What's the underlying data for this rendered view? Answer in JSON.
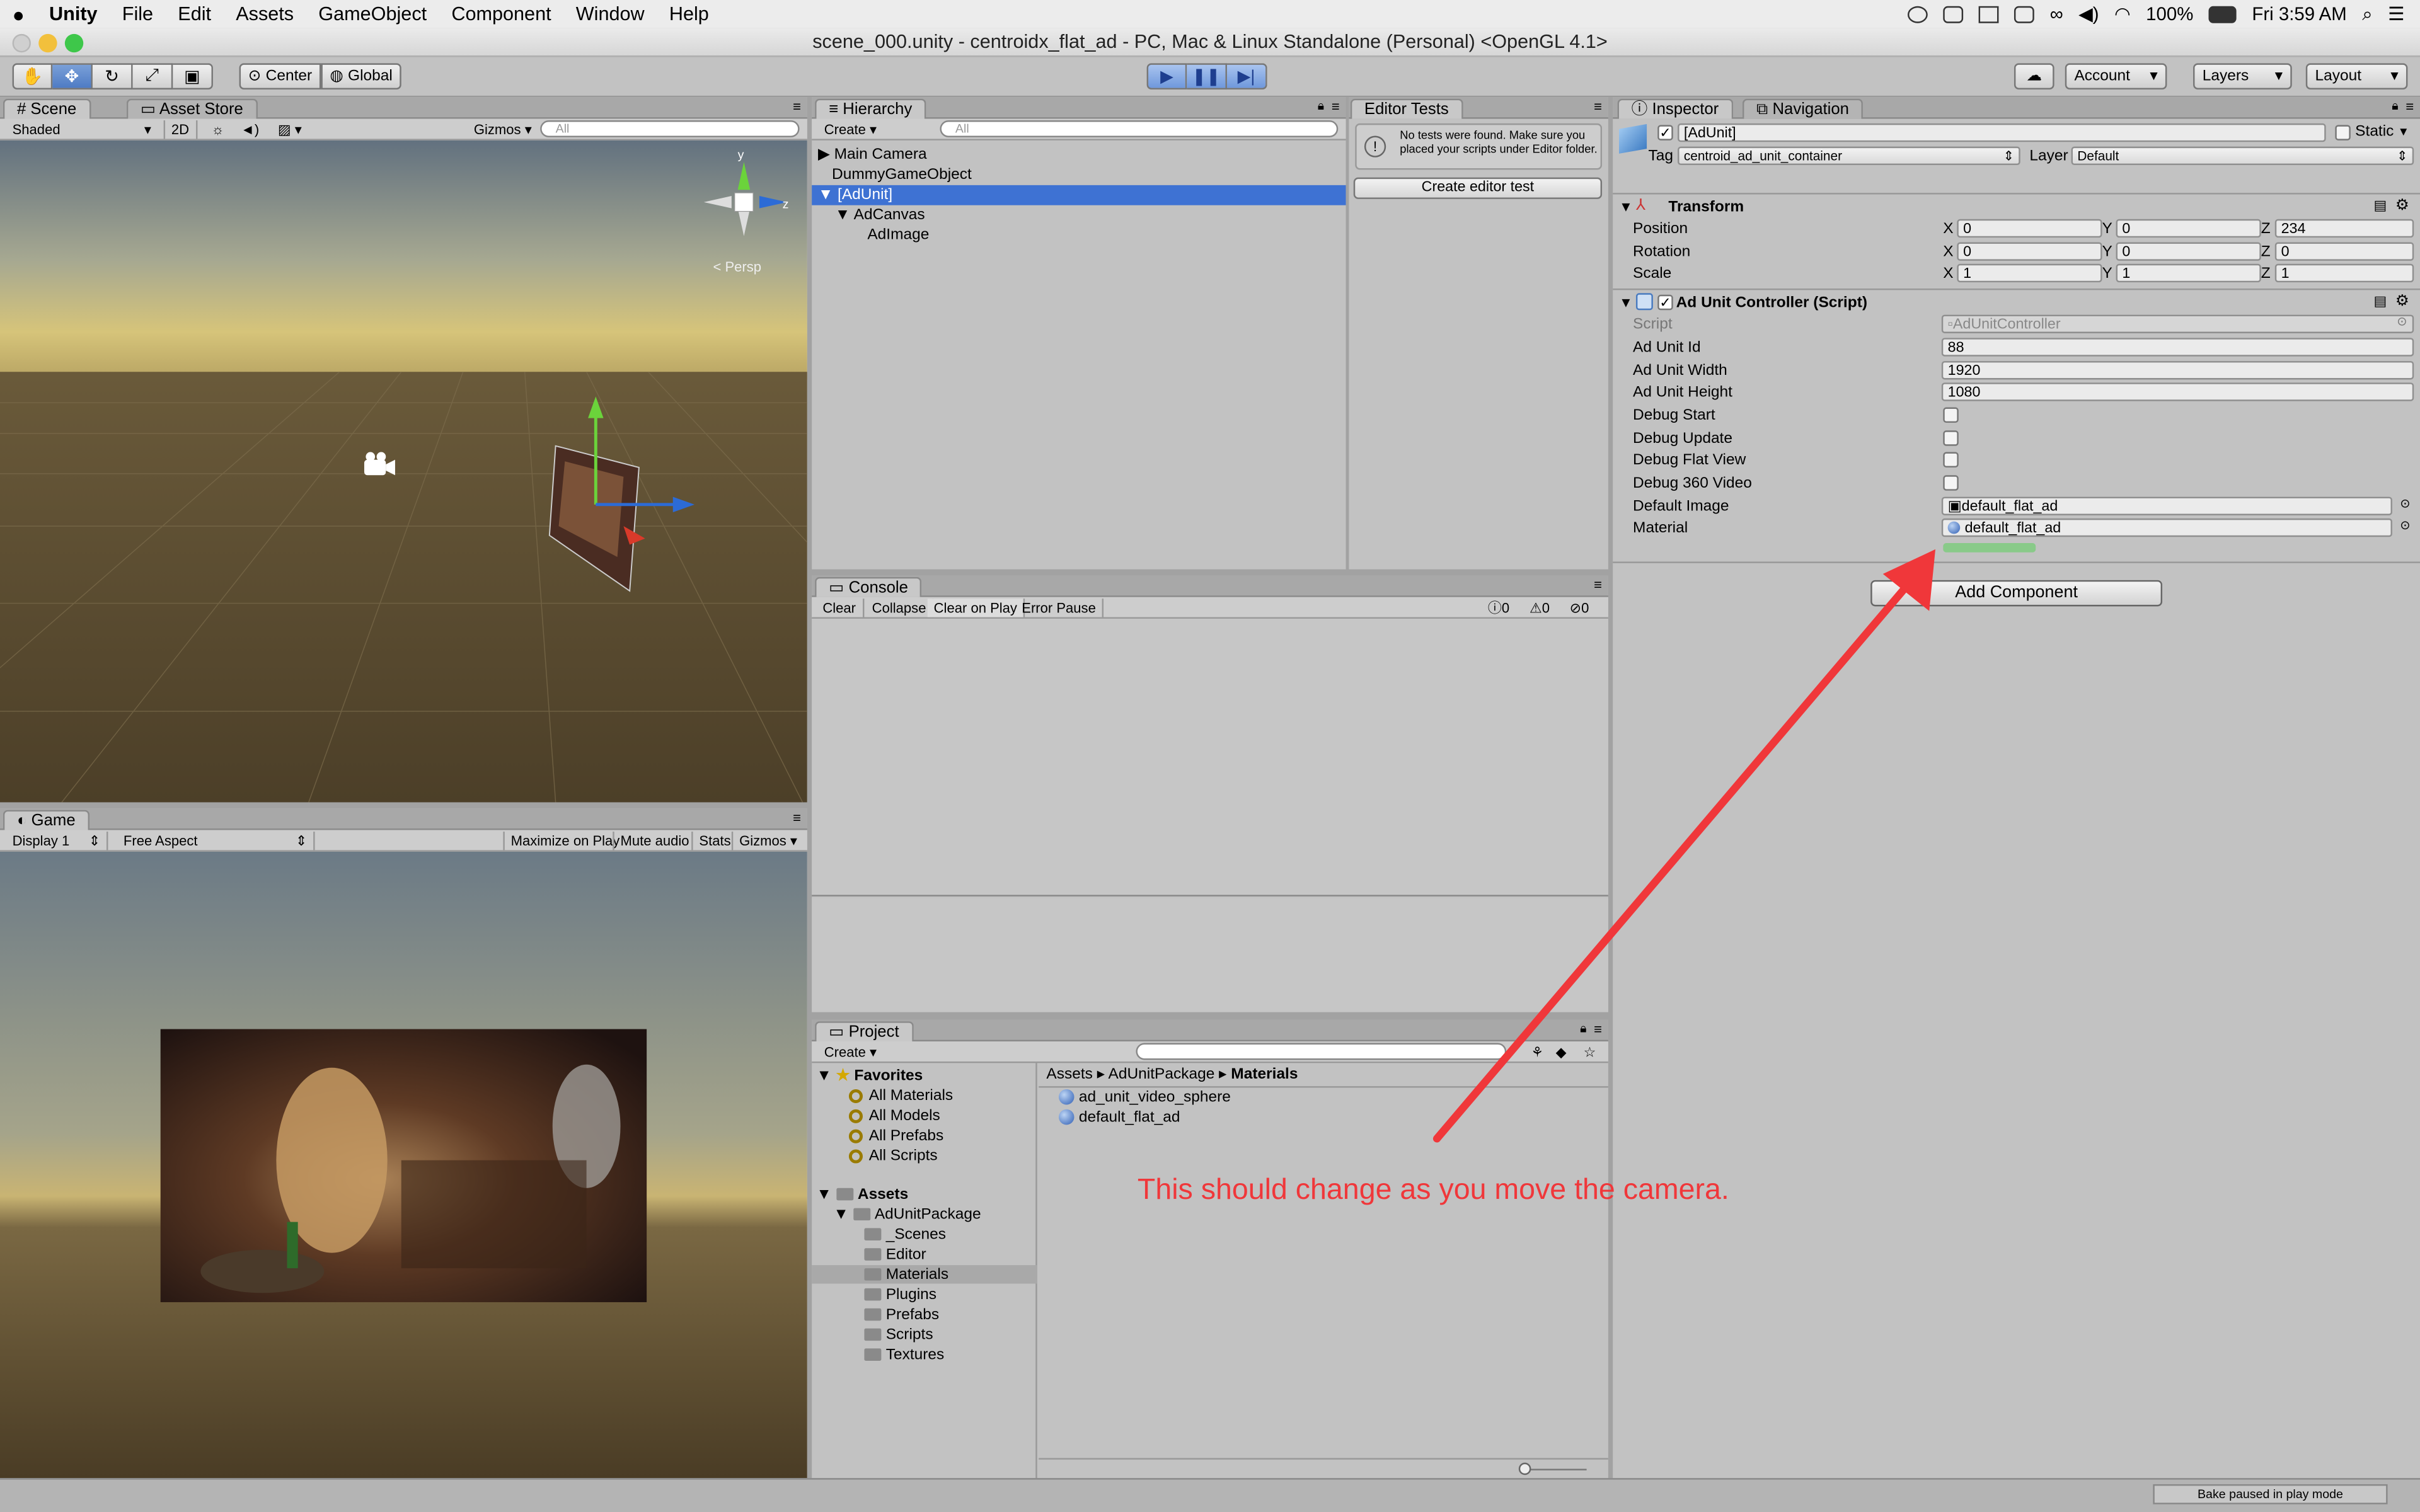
{
  "menubar": {
    "app": "Unity",
    "items": [
      "File",
      "Edit",
      "Assets",
      "GameObject",
      "Component",
      "Window",
      "Help"
    ],
    "battery": "100%",
    "clock": "Fri 3:59 AM"
  },
  "window": {
    "title": "scene_000.unity - centroidx_flat_ad - PC, Mac & Linux Standalone (Personal) <OpenGL 4.1>"
  },
  "toolbar": {
    "pivot": "Center",
    "space": "Global",
    "account": "Account",
    "layers": "Layers",
    "layout": "Layout"
  },
  "scene": {
    "tabs": [
      "Scene",
      "Asset Store"
    ],
    "shading": "Shaded",
    "mode2d": "2D",
    "gizmos": "Gizmos",
    "search_placeholder": "All",
    "persp": "Persp",
    "axis_y": "y",
    "axis_z": "z"
  },
  "game": {
    "tab": "Game",
    "display": "Display 1",
    "aspect": "Free Aspect",
    "buttons": [
      "Maximize on Play",
      "Mute audio",
      "Stats",
      "Gizmos"
    ]
  },
  "hierarchy": {
    "tab": "Hierarchy",
    "create": "Create",
    "search_placeholder": "All",
    "items": [
      "Main Camera",
      "DummyGameObject",
      "[AdUnit]",
      "AdCanvas",
      "AdImage"
    ]
  },
  "editor_tests": {
    "tab": "Editor Tests",
    "message": "No tests were found. Make sure you placed your scripts under Editor folder.",
    "button": "Create editor test"
  },
  "console": {
    "tab": "Console",
    "buttons": [
      "Clear",
      "Collapse",
      "Clear on Play",
      "Error Pause"
    ],
    "counts": [
      "0",
      "0",
      "0"
    ]
  },
  "project": {
    "tab": "Project",
    "create": "Create",
    "favorites_label": "Favorites",
    "favorites": [
      "All Materials",
      "All Models",
      "All Prefabs",
      "All Scripts"
    ],
    "assets_label": "Assets",
    "package": "AdUnitPackage",
    "folders": [
      "_Scenes",
      "Editor",
      "Materials",
      "Plugins",
      "Prefabs",
      "Scripts",
      "Textures"
    ],
    "breadcrumb": [
      "Assets",
      "AdUnitPackage",
      "Materials"
    ],
    "files": [
      "ad_unit_video_sphere",
      "default_flat_ad"
    ]
  },
  "inspector": {
    "tabs": [
      "Inspector",
      "Navigation"
    ],
    "object_name": "[AdUnit]",
    "static": "Static",
    "tag_label": "Tag",
    "tag_value": "centroid_ad_unit_container",
    "layer_label": "Layer",
    "layer_value": "Default",
    "transform": {
      "title": "Transform",
      "rows": [
        {
          "label": "Position",
          "x": "0",
          "y": "0",
          "z": "234"
        },
        {
          "label": "Rotation",
          "x": "0",
          "y": "0",
          "z": "0"
        },
        {
          "label": "Scale",
          "x": "1",
          "y": "1",
          "z": "1"
        }
      ],
      "axis": [
        "X",
        "Y",
        "Z"
      ]
    },
    "script": {
      "title": "Ad Unit Controller (Script)",
      "script_label": "Script",
      "script_value": "AdUnitController",
      "fields": [
        {
          "label": "Ad Unit Id",
          "value": "88"
        },
        {
          "label": "Ad Unit Width",
          "value": "1920"
        },
        {
          "label": "Ad Unit Height",
          "value": "1080"
        }
      ],
      "toggles": [
        "Debug Start",
        "Debug Update",
        "Debug Flat View",
        "Debug 360 Video"
      ],
      "objects": [
        {
          "label": "Default Image",
          "value": "default_flat_ad"
        },
        {
          "label": "Material",
          "value": "default_flat_ad"
        }
      ]
    },
    "add_component": "Add Component"
  },
  "annotation": {
    "text": "This should change as you move the camera.",
    "color": "#f0373a"
  },
  "status": {
    "bake": "Bake paused in play mode"
  }
}
